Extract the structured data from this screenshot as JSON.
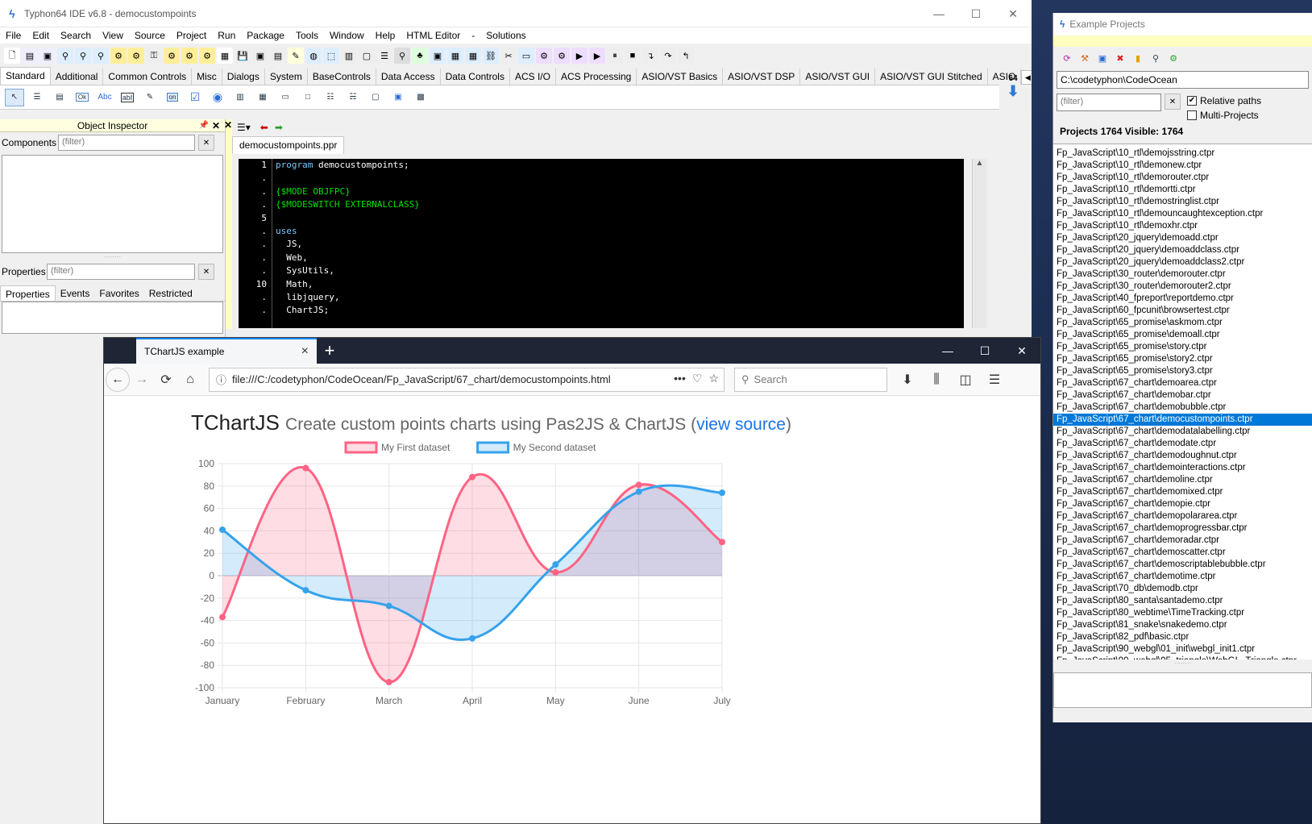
{
  "ide": {
    "title": "Typhon64 IDE v6.8 - democustompoints",
    "menu": [
      "File",
      "Edit",
      "Search",
      "View",
      "Source",
      "Project",
      "Run",
      "Package",
      "Tools",
      "Window",
      "Help",
      "HTML Editor",
      "-",
      "Solutions"
    ],
    "palette_tabs": [
      "Standard",
      "Additional",
      "Common Controls",
      "Misc",
      "Dialogs",
      "System",
      "BaseControls",
      "Data Access",
      "Data Controls",
      "ACS I/O",
      "ACS Processing",
      "ASIO/VST Basics",
      "ASIO/VST DSP",
      "ASIO/VST GUI",
      "ASIO/VST GUI Stitched",
      "ASIO"
    ],
    "palette_badge": "64",
    "palette_items": [
      "Ok",
      "Abc",
      "abI",
      "on"
    ],
    "object_inspector": {
      "title": "Object Inspector",
      "components_label": "Components",
      "components_filter": "(filter)",
      "properties_label": "Properties",
      "properties_filter": "(filter)",
      "tabs": [
        "Properties",
        "Events",
        "Favorites",
        "Restricted"
      ]
    },
    "editor": {
      "tab": "democustompoints.ppr",
      "gutter": [
        "1",
        ".",
        ".",
        ".",
        "5",
        ".",
        ".",
        ".",
        ".",
        "10",
        ".",
        "."
      ],
      "lines": [
        {
          "kw": "program",
          "rest": " democustompoints;"
        },
        {
          "kw": "",
          "rest": ""
        },
        {
          "dir": "{$MODE OBJFPC}"
        },
        {
          "dir": "{$MODESWITCH EXTERNALCLASS}"
        },
        {
          "kw": "",
          "rest": ""
        },
        {
          "kw": "uses",
          "rest": ""
        },
        {
          "kw": "",
          "rest": "  JS,"
        },
        {
          "kw": "",
          "rest": "  Web,"
        },
        {
          "kw": "",
          "rest": "  SysUtils,"
        },
        {
          "kw": "",
          "rest": "  Math,"
        },
        {
          "kw": "",
          "rest": "  libjquery,"
        },
        {
          "kw": "",
          "rest": "  ChartJS;"
        }
      ]
    }
  },
  "examples": {
    "title": "Example Projects",
    "path": "C:\\codetyphon\\CodeOcean",
    "filter": "(filter)",
    "relative_paths": "Relative paths",
    "multi_projects": "Multi-Projects",
    "count": "Projects 1764  Visible: 1764",
    "selected_index": 22,
    "items": [
      "Fp_JavaScript\\10_rtl\\demojsstring.ctpr",
      "Fp_JavaScript\\10_rtl\\demonew.ctpr",
      "Fp_JavaScript\\10_rtl\\demorouter.ctpr",
      "Fp_JavaScript\\10_rtl\\demortti.ctpr",
      "Fp_JavaScript\\10_rtl\\demostringlist.ctpr",
      "Fp_JavaScript\\10_rtl\\demouncaughtexception.ctpr",
      "Fp_JavaScript\\10_rtl\\demoxhr.ctpr",
      "Fp_JavaScript\\20_jquery\\demoadd.ctpr",
      "Fp_JavaScript\\20_jquery\\demoaddclass.ctpr",
      "Fp_JavaScript\\20_jquery\\demoaddclass2.ctpr",
      "Fp_JavaScript\\30_router\\demorouter.ctpr",
      "Fp_JavaScript\\30_router\\demorouter2.ctpr",
      "Fp_JavaScript\\40_fpreport\\reportdemo.ctpr",
      "Fp_JavaScript\\60_fpcunit\\browsertest.ctpr",
      "Fp_JavaScript\\65_promise\\askmom.ctpr",
      "Fp_JavaScript\\65_promise\\demoall.ctpr",
      "Fp_JavaScript\\65_promise\\story.ctpr",
      "Fp_JavaScript\\65_promise\\story2.ctpr",
      "Fp_JavaScript\\65_promise\\story3.ctpr",
      "Fp_JavaScript\\67_chart\\demoarea.ctpr",
      "Fp_JavaScript\\67_chart\\demobar.ctpr",
      "Fp_JavaScript\\67_chart\\demobubble.ctpr",
      "Fp_JavaScript\\67_chart\\democustompoints.ctpr",
      "Fp_JavaScript\\67_chart\\demodatalabelling.ctpr",
      "Fp_JavaScript\\67_chart\\demodate.ctpr",
      "Fp_JavaScript\\67_chart\\demodoughnut.ctpr",
      "Fp_JavaScript\\67_chart\\demointeractions.ctpr",
      "Fp_JavaScript\\67_chart\\demoline.ctpr",
      "Fp_JavaScript\\67_chart\\demomixed.ctpr",
      "Fp_JavaScript\\67_chart\\demopie.ctpr",
      "Fp_JavaScript\\67_chart\\demopolararea.ctpr",
      "Fp_JavaScript\\67_chart\\demoprogressbar.ctpr",
      "Fp_JavaScript\\67_chart\\demoradar.ctpr",
      "Fp_JavaScript\\67_chart\\demoscatter.ctpr",
      "Fp_JavaScript\\67_chart\\demoscriptablebubble.ctpr",
      "Fp_JavaScript\\67_chart\\demotime.ctpr",
      "Fp_JavaScript\\70_db\\demodb.ctpr",
      "Fp_JavaScript\\80_santa\\santademo.ctpr",
      "Fp_JavaScript\\80_webtime\\TimeTracking.ctpr",
      "Fp_JavaScript\\81_snake\\snakedemo.ctpr",
      "Fp_JavaScript\\82_pdf\\basic.ctpr",
      "Fp_JavaScript\\90_webgl\\01_init\\webgl_init1.ctpr",
      "Fp_JavaScript\\90_webgl\\05_triangle\\WebGL_Triangle.ctpr"
    ]
  },
  "browser": {
    "tab_title": "TChartJS example",
    "url": "file:///C:/codetyphon/CodeOcean/Fp_JavaScript/67_chart/democustompoints.html",
    "search_placeholder": "Search",
    "heading": "TChartJS",
    "subheading": "Create custom points charts using Pas2JS & ChartJS (",
    "link": "view source",
    "close_paren": ")"
  },
  "colors": {
    "series1": "#ff6384",
    "series2": "#36a2eb",
    "selection": "#0078d7"
  },
  "chart_data": {
    "type": "line",
    "categories": [
      "January",
      "February",
      "March",
      "April",
      "May",
      "June",
      "July"
    ],
    "ylim": [
      -100,
      100
    ],
    "yticks": [
      100,
      80,
      60,
      40,
      20,
      0,
      -20,
      -40,
      -60,
      -80,
      -100
    ],
    "grid": true,
    "legend": "top",
    "series": [
      {
        "name": "My First dataset",
        "values": [
          -37,
          96,
          -95,
          88,
          3,
          81,
          30
        ]
      },
      {
        "name": "My Second dataset",
        "values": [
          41,
          -13,
          -27,
          -56,
          10,
          75,
          74
        ]
      }
    ]
  }
}
